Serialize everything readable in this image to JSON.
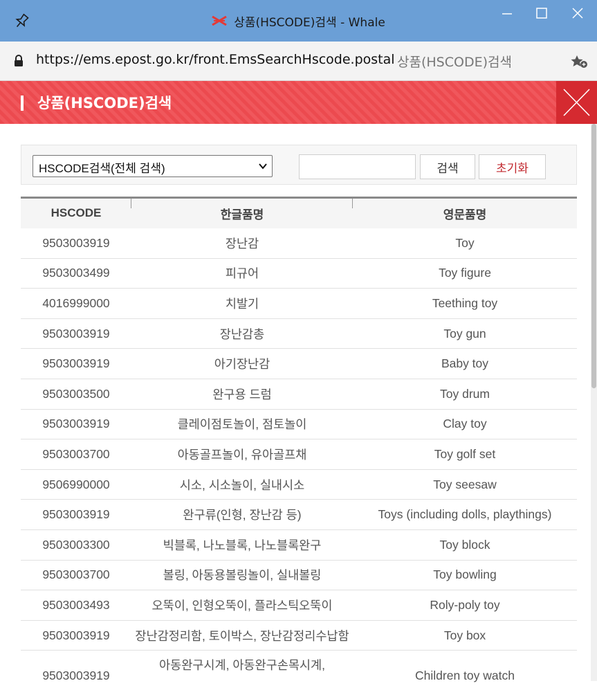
{
  "window": {
    "title": "상품(HSCODE)검색 - Whale",
    "controls": {
      "minimize": "–",
      "maximize": "☐",
      "close": "✕"
    }
  },
  "address_bar": {
    "url": "https://ems.epost.go.kr/front.EmsSearchHscode.postal",
    "page_title": "상품(HSCODE)검색"
  },
  "header": {
    "title": "상품(HSCODE)검색",
    "accent_color": "#ec4a4f"
  },
  "search": {
    "select_value": "HSCODE검색(전체 검색)",
    "input_value": "",
    "search_button": "검색",
    "reset_button": "초기화"
  },
  "table": {
    "columns": [
      "HSCODE",
      "한글품명",
      "영문품명"
    ],
    "rows": [
      {
        "hscode": "9503003919",
        "ko": "장난감",
        "en": "Toy"
      },
      {
        "hscode": "9503003499",
        "ko": "피규어",
        "en": "Toy figure"
      },
      {
        "hscode": "4016999000",
        "ko": "치발기",
        "en": "Teething toy"
      },
      {
        "hscode": "9503003919",
        "ko": "장난감총",
        "en": "Toy gun"
      },
      {
        "hscode": "9503003919",
        "ko": "아기장난감",
        "en": "Baby toy"
      },
      {
        "hscode": "9503003500",
        "ko": "완구용 드럼",
        "en": "Toy drum"
      },
      {
        "hscode": "9503003919",
        "ko": "클레이점토놀이, 점토놀이",
        "en": "Clay toy"
      },
      {
        "hscode": "9503003700",
        "ko": "아동골프놀이, 유아골프채",
        "en": "Toy golf set"
      },
      {
        "hscode": "9506990000",
        "ko": "시소, 시소놀이, 실내시소",
        "en": "Toy seesaw"
      },
      {
        "hscode": "9503003919",
        "ko": "완구류(인형, 장난감 등)",
        "en": "Toys (including dolls, playthings)"
      },
      {
        "hscode": "9503003300",
        "ko": "빅블록, 나노블록, 나노블록완구",
        "en": "Toy block"
      },
      {
        "hscode": "9503003700",
        "ko": "볼링, 아동용볼링놀이, 실내볼링",
        "en": "Toy bowling"
      },
      {
        "hscode": "9503003493",
        "ko": "오뚝이, 인형오뚝이, 플라스틱오뚝이",
        "en": "Roly-poly toy"
      },
      {
        "hscode": "9503003919",
        "ko": "장난감정리함, 토이박스, 장난감정리수납함",
        "en": "Toy box"
      },
      {
        "hscode": "9503003919",
        "ko": "아동완구시계, 아동완구손목시계,",
        "en": "Children toy watch"
      }
    ]
  },
  "colors": {
    "titlebar": "#6b9fd6",
    "header_red": "#ec4a4f",
    "close_red": "#d52a30",
    "reset_text": "#c1272d"
  }
}
